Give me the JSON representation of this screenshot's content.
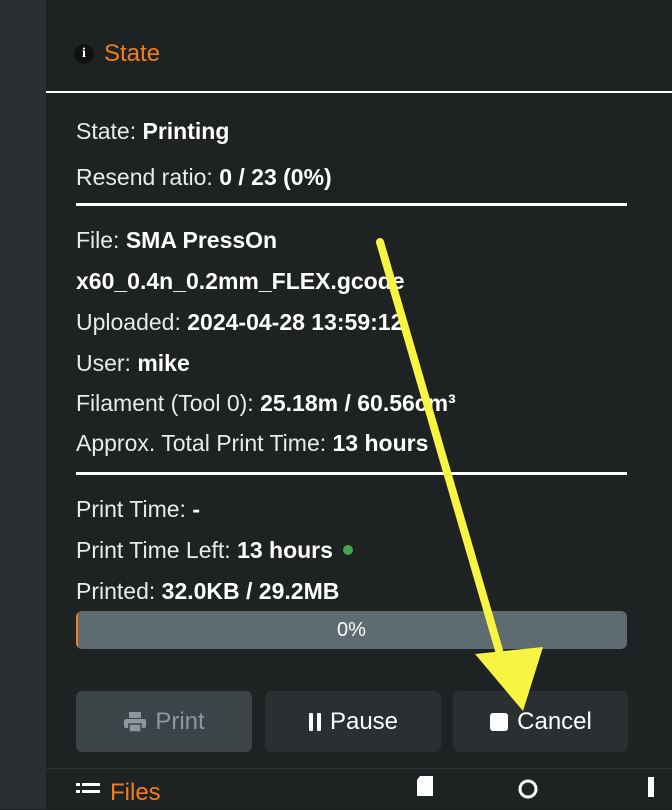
{
  "state_panel": {
    "title": "State",
    "state_label": "State: ",
    "state_value": "Printing",
    "resend_label": "Resend ratio: ",
    "resend_value": "0 / 23 (0%)",
    "file_label": "File: ",
    "file_value_line1": "SMA PressOn",
    "file_value_line2": "x60_0.4n_0.2mm_FLEX.gcode",
    "uploaded_label": "Uploaded: ",
    "uploaded_value": "2024-04-28 13:59:12",
    "user_label": "User: ",
    "user_value": "mike",
    "filament_label": "Filament (Tool 0): ",
    "filament_value": "25.18m / 60.56cm³",
    "approx_label": "Approx. Total Print Time: ",
    "approx_value": "13 hours",
    "print_time_label": "Print Time: ",
    "print_time_value": "-",
    "time_left_label": "Print Time Left: ",
    "time_left_value": "13 hours",
    "printed_label": "Printed: ",
    "printed_value": "32.0KB / 29.2MB",
    "progress_text": "0%",
    "progress_fraction": 0.003
  },
  "buttons": {
    "print": "Print",
    "pause": "Pause",
    "cancel": "Cancel"
  },
  "files_panel": {
    "title": "Files"
  },
  "colors": {
    "accent": "#f07e1f",
    "annotation_arrow": "#f7f542",
    "status_dot": "#41a84e"
  }
}
